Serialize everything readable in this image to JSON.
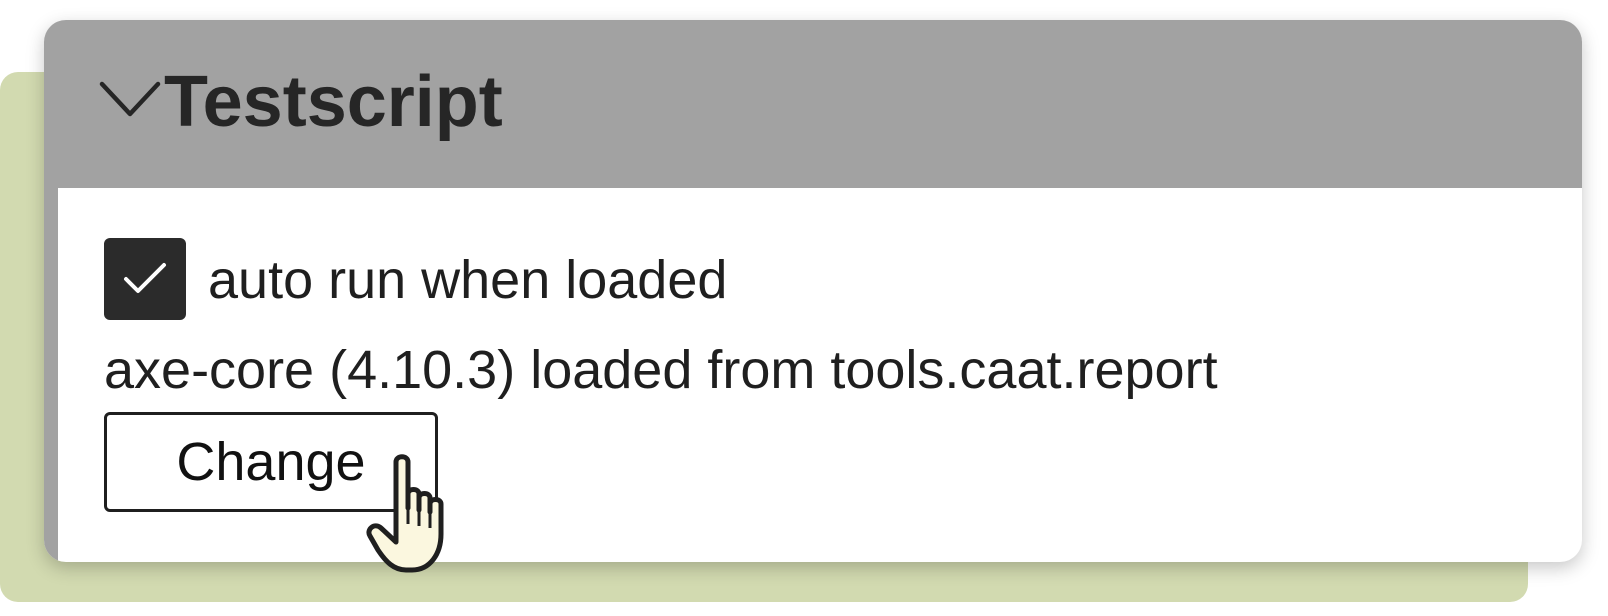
{
  "panel": {
    "title": "Testscript",
    "expanded": true
  },
  "autorun": {
    "label": "auto run when loaded",
    "checked": true
  },
  "status": {
    "text": "axe-core (4.10.3) loaded from tools.caat.report"
  },
  "change_button": {
    "label": "Change"
  },
  "icons": {
    "chevron": "chevron-down-icon",
    "check": "checkmark-icon",
    "cursor": "hand-pointer-icon"
  },
  "colors": {
    "header_bg": "#a2a2a2",
    "backdrop": "#d2dab0",
    "checkbox_fill": "#2b2b2b",
    "cursor_fill": "#fbf7df"
  }
}
